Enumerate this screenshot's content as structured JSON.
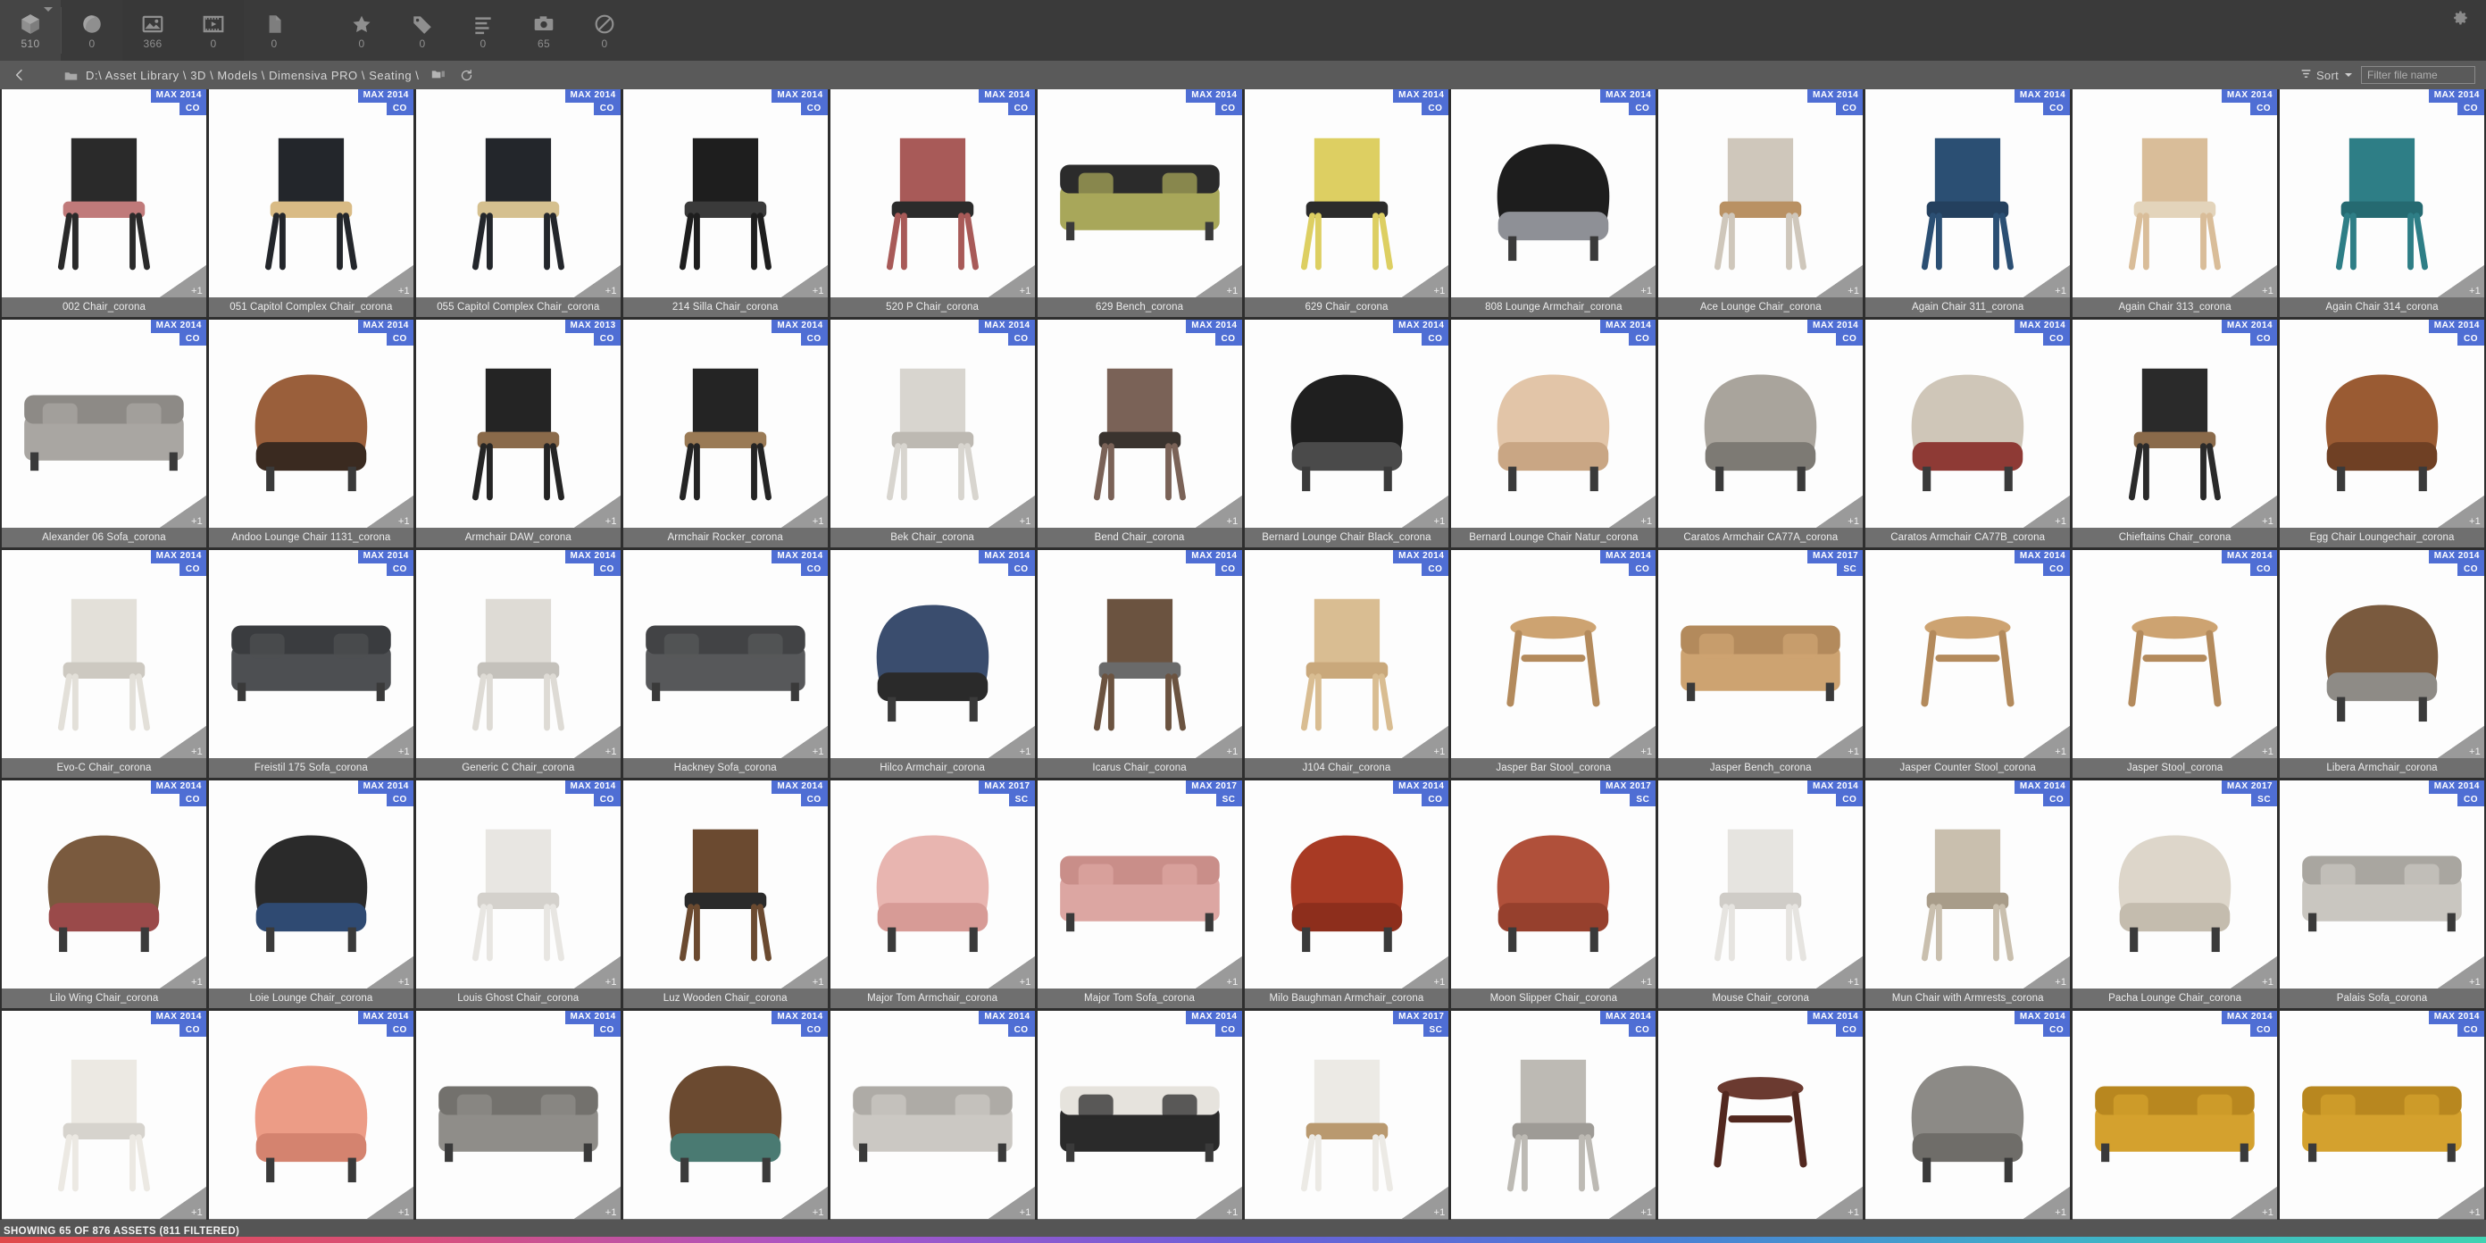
{
  "toolbar": {
    "tabs": [
      {
        "name": "models",
        "icon": "cube-icon",
        "count": "510",
        "state": "active",
        "has_caret": true
      },
      {
        "name": "materials",
        "icon": "sphere-icon",
        "count": "0",
        "state": "normal",
        "has_caret": false
      },
      {
        "name": "images",
        "icon": "image-icon",
        "count": "366",
        "state": "selected",
        "has_caret": false
      },
      {
        "name": "video",
        "icon": "film-icon",
        "count": "0",
        "state": "selected",
        "has_caret": false
      },
      {
        "name": "documents",
        "icon": "document-icon",
        "count": "0",
        "state": "dim",
        "has_caret": false
      },
      {
        "name": "favorites",
        "icon": "star-icon",
        "count": "0",
        "state": "normal",
        "has_caret": false
      },
      {
        "name": "tags",
        "icon": "tag-icon",
        "count": "0",
        "state": "normal",
        "has_caret": false
      },
      {
        "name": "lists",
        "icon": "list-icon",
        "count": "0",
        "state": "normal",
        "has_caret": false
      },
      {
        "name": "renders",
        "icon": "camera-icon",
        "count": "65",
        "state": "normal",
        "has_caret": false
      },
      {
        "name": "excluded",
        "icon": "forbidden-icon",
        "count": "0",
        "state": "normal",
        "has_caret": false
      }
    ],
    "settings_icon": "gear-icon"
  },
  "pathbar": {
    "back_icon": "chevron-left-icon",
    "folder_icon": "folder-icon",
    "path": "D:\\ Asset Library \\ 3D \\ Models \\ Dimensiva PRO \\ Seating \\",
    "copy_icon": "copy-folder-icon",
    "refresh_icon": "refresh-icon",
    "sort_label": "Sort",
    "sort_icon": "sort-icon",
    "filter_placeholder": "Filter file name",
    "filter_value": ""
  },
  "status": {
    "text": "SHOWING 65 OF 876 ASSETS (811 FILTERED)",
    "gradient": [
      "#e04a4a",
      "#d94f7a",
      "#a855c8",
      "#6b5fd8",
      "#4a7fd4",
      "#3fb0c8",
      "#3fd3b2"
    ]
  },
  "badge_colors": {
    "blue": "#4f6ed4",
    "corner": "#9a9a9a"
  },
  "assets": [
    {
      "name": "002 Chair_corona",
      "max": "MAX 2014",
      "renderer": "CO",
      "extra": "+1",
      "art": "chair-bent-black-rose"
    },
    {
      "name": "051 Capitol Complex Chair_corona",
      "max": "MAX 2014",
      "renderer": "CO",
      "extra": "+1",
      "art": "chair-cane-black"
    },
    {
      "name": "055 Capitol Complex Chair_corona",
      "max": "MAX 2014",
      "renderer": "CO",
      "extra": "+1",
      "art": "chair-cane-side"
    },
    {
      "name": "214 Silla Chair_corona",
      "max": "MAX 2014",
      "renderer": "CO",
      "extra": "+1",
      "art": "chair-thonet-black"
    },
    {
      "name": "520 P Chair_corona",
      "max": "MAX 2014",
      "renderer": "CO",
      "extra": "+1",
      "art": "chair-upholstered-red"
    },
    {
      "name": "629 Bench_corona",
      "max": "MAX 2014",
      "renderer": "CO",
      "extra": "+1",
      "art": "bench-olive"
    },
    {
      "name": "629 Chair_corona",
      "max": "MAX 2014",
      "renderer": "CO",
      "extra": "+1",
      "art": "chair-yellow-swivel"
    },
    {
      "name": "808 Lounge Armchair_corona",
      "max": "MAX 2014",
      "renderer": "CO",
      "extra": "+1",
      "art": "lounge-black-leather"
    },
    {
      "name": "Ace Lounge Chair_corona",
      "max": "MAX 2014",
      "renderer": "CO",
      "extra": "+1",
      "art": "chair-beige-wood-legs"
    },
    {
      "name": "Again Chair 311_corona",
      "max": "MAX 2014",
      "renderer": "CO",
      "extra": "+1",
      "art": "chair-navy-round"
    },
    {
      "name": "Again Chair 313_corona",
      "max": "MAX 2014",
      "renderer": "CO",
      "extra": "+1",
      "art": "chair-light-wood-round"
    },
    {
      "name": "Again Chair 314_corona",
      "max": "MAX 2014",
      "renderer": "CO",
      "extra": "+1",
      "art": "chair-teal-round"
    },
    {
      "name": "Alexander 06 Sofa_corona",
      "max": "MAX 2014",
      "renderer": "CO",
      "extra": "+1",
      "art": "sofa-sectional-grey"
    },
    {
      "name": "Andoo Lounge Chair 1131_corona",
      "max": "MAX 2014",
      "renderer": "CO",
      "extra": "+1",
      "art": "lounge-tan-leather"
    },
    {
      "name": "Armchair DAW_corona",
      "max": "MAX 2013",
      "renderer": "CO",
      "extra": "+1",
      "art": "chair-daw-black"
    },
    {
      "name": "Armchair Rocker_corona",
      "max": "MAX 2014",
      "renderer": "CO",
      "extra": "+1",
      "art": "chair-rocker-black"
    },
    {
      "name": "Bek Chair_corona",
      "max": "MAX 2014",
      "renderer": "CO",
      "extra": "+1",
      "art": "chair-folding-white"
    },
    {
      "name": "Bend Chair_corona",
      "max": "MAX 2014",
      "renderer": "CO",
      "extra": "+1",
      "art": "chair-brown-upholstered"
    },
    {
      "name": "Bernard Lounge Chair Black_corona",
      "max": "MAX 2014",
      "renderer": "CO",
      "extra": "+1",
      "art": "lounge-black-sling"
    },
    {
      "name": "Bernard Lounge Chair Natur_corona",
      "max": "MAX 2014",
      "renderer": "CO",
      "extra": "+1",
      "art": "lounge-natural-sling"
    },
    {
      "name": "Caratos Armchair CA77A_corona",
      "max": "MAX 2014",
      "renderer": "CO",
      "extra": "+1",
      "art": "armchair-grey-wing"
    },
    {
      "name": "Caratos Armchair CA77B_corona",
      "max": "MAX 2014",
      "renderer": "CO",
      "extra": "+1",
      "art": "armchair-cream-red"
    },
    {
      "name": "Chieftains Chair_corona",
      "max": "MAX 2014",
      "renderer": "CO",
      "extra": "+1",
      "art": "chair-chieftain-black"
    },
    {
      "name": "Egg Chair Loungechair_corona",
      "max": "MAX 2014",
      "renderer": "CO",
      "extra": "+1",
      "art": "chair-egg-brown"
    },
    {
      "name": "Evo-C Chair_corona",
      "max": "MAX 2014",
      "renderer": "CO",
      "extra": "+1",
      "art": "chair-molded-white"
    },
    {
      "name": "Freistil 175 Sofa_corona",
      "max": "MAX 2014",
      "renderer": "CO",
      "extra": "+1",
      "art": "sofa-dark-grey"
    },
    {
      "name": "Generic C Chair_corona",
      "max": "MAX 2014",
      "renderer": "CO",
      "extra": "+1",
      "art": "chair-wire-white"
    },
    {
      "name": "Hackney Sofa_corona",
      "max": "MAX 2014",
      "renderer": "CO",
      "extra": "+1",
      "art": "sofa-charcoal-loveseat"
    },
    {
      "name": "Hilco Armchair_corona",
      "max": "MAX 2014",
      "renderer": "CO",
      "extra": "+1",
      "art": "armchair-navy-swivel"
    },
    {
      "name": "Icarus Chair_corona",
      "max": "MAX 2014",
      "renderer": "CO",
      "extra": "+1",
      "art": "chair-wood-white-seat"
    },
    {
      "name": "J104 Chair_corona",
      "max": "MAX 2014",
      "renderer": "CO",
      "extra": "+1",
      "art": "chair-windsor-light"
    },
    {
      "name": "Jasper Bar Stool_corona",
      "max": "MAX 2014",
      "renderer": "CO",
      "extra": "+1",
      "art": "stool-bar-oak"
    },
    {
      "name": "Jasper Bench_corona",
      "max": "MAX 2017",
      "renderer": "SC",
      "extra": "+1",
      "art": "bench-oak"
    },
    {
      "name": "Jasper Counter Stool_corona",
      "max": "MAX 2014",
      "renderer": "CO",
      "extra": "+1",
      "art": "stool-counter-oak"
    },
    {
      "name": "Jasper Stool_corona",
      "max": "MAX 2014",
      "renderer": "CO",
      "extra": "+1",
      "art": "stool-low-oak"
    },
    {
      "name": "Libera Armchair_corona",
      "max": "MAX 2014",
      "renderer": "CO",
      "extra": "+1",
      "art": "armchair-wood-grey"
    },
    {
      "name": "Lilo Wing Chair_corona",
      "max": "MAX 2014",
      "renderer": "CO",
      "extra": "+1",
      "art": "chair-wing-multicolor"
    },
    {
      "name": "Loie Lounge Chair_corona",
      "max": "MAX 2014",
      "renderer": "CO",
      "extra": "+1",
      "art": "lounge-navy-cane"
    },
    {
      "name": "Louis Ghost Chair_corona",
      "max": "MAX 2014",
      "renderer": "CO",
      "extra": "+1",
      "art": "chair-ghost-clear"
    },
    {
      "name": "Luz Wooden Chair_corona",
      "max": "MAX 2014",
      "renderer": "CO",
      "extra": "+1",
      "art": "chair-wood-walnut"
    },
    {
      "name": "Major Tom Armchair_corona",
      "max": "MAX 2017",
      "renderer": "SC",
      "extra": "+1",
      "art": "armchair-pink-puffy"
    },
    {
      "name": "Major Tom Sofa_corona",
      "max": "MAX 2017",
      "renderer": "SC",
      "extra": "+1",
      "art": "sofa-pink-puffy"
    },
    {
      "name": "Milo Baughman Armchair_corona",
      "max": "MAX 2014",
      "renderer": "CO",
      "extra": "+1",
      "art": "armchair-rust-velvet"
    },
    {
      "name": "Moon Slipper Chair_corona",
      "max": "MAX 2017",
      "renderer": "SC",
      "extra": "+1",
      "art": "chair-rust-slipper"
    },
    {
      "name": "Mouse Chair_corona",
      "max": "MAX 2014",
      "renderer": "CO",
      "extra": "+1",
      "art": "chair-mouse-white"
    },
    {
      "name": "Mun Chair with Armrests_corona",
      "max": "MAX 2014",
      "renderer": "CO",
      "extra": "+1",
      "art": "chair-beige-arms"
    },
    {
      "name": "Pacha Lounge Chair_corona",
      "max": "MAX 2017",
      "renderer": "SC",
      "extra": "+1",
      "art": "lounge-pacha-cream"
    },
    {
      "name": "Palais Sofa_corona",
      "max": "MAX 2014",
      "renderer": "CO",
      "extra": "+1",
      "art": "sofa-palais-grey"
    },
    {
      "name": "",
      "max": "MAX 2014",
      "renderer": "CO",
      "extra": "+1",
      "art": "chair-panton-white"
    },
    {
      "name": "",
      "max": "MAX 2014",
      "renderer": "CO",
      "extra": "+1",
      "art": "armchair-salmon-tufted"
    },
    {
      "name": "",
      "max": "MAX 2014",
      "renderer": "CO",
      "extra": "+1",
      "art": "sofa-grey-modular"
    },
    {
      "name": "",
      "max": "MAX 2014",
      "renderer": "CO",
      "extra": "+1",
      "art": "armchair-wood-teal"
    },
    {
      "name": "",
      "max": "MAX 2014",
      "renderer": "CO",
      "extra": "+1",
      "art": "sofa-light-grey-long"
    },
    {
      "name": "",
      "max": "MAX 2014",
      "renderer": "CO",
      "extra": "+1",
      "art": "sofa-striped-swirl"
    },
    {
      "name": "",
      "max": "MAX 2017",
      "renderer": "SC",
      "extra": "+1",
      "art": "chair-eames-white"
    },
    {
      "name": "",
      "max": "MAX 2014",
      "renderer": "CO",
      "extra": "+1",
      "art": "chair-folding-wire"
    },
    {
      "name": "",
      "max": "MAX 2014",
      "renderer": "CO",
      "extra": "+1",
      "art": "stool-hourglass-brown"
    },
    {
      "name": "",
      "max": "MAX 2014",
      "renderer": "CO",
      "extra": "+1",
      "art": "armchair-grey-high"
    },
    {
      "name": "",
      "max": "MAX 2014",
      "renderer": "CO",
      "extra": "+1",
      "art": "sofa-togo-mustard"
    },
    {
      "name": "",
      "max": "MAX 2014",
      "renderer": "CO",
      "extra": "+1",
      "art": "sofa-togo-mustard-low"
    }
  ]
}
